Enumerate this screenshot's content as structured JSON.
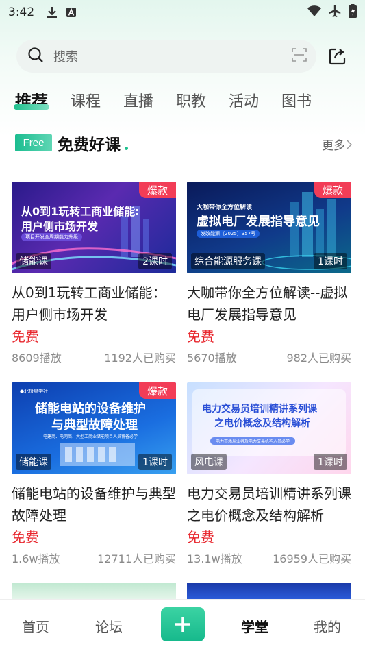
{
  "status_bar": {
    "time": "3:42"
  },
  "search": {
    "placeholder": "搜索"
  },
  "tabs": [
    "推荐",
    "课程",
    "直播",
    "职教",
    "活动",
    "图书"
  ],
  "section": {
    "tag": "Free",
    "title": "免费好课",
    "more": "更多"
  },
  "courses": [
    {
      "badge": "爆款",
      "thumb_title_1": "从0到1玩转工商业储能:",
      "thumb_title_2": "用户侧市场开发",
      "thumb_sub": "项目开发全周期能力升级",
      "category": "储能课",
      "duration": "2课时",
      "title": "从0到1玩转工商业储能：用户侧市场开发",
      "price": "免费",
      "plays": "8609播放",
      "buyers": "1192人已购买"
    },
    {
      "badge": "爆款",
      "thumb_title_1": "大咖带你全方位解读",
      "thumb_title_2": "虚拟电厂发展指导意见",
      "thumb_sub": "发改能源〔2025〕357号",
      "category": "综合能源服务课",
      "duration": "1课时",
      "title": "大咖带你全方位解读--虚拟电厂发展指导意见",
      "price": "免费",
      "plays": "5670播放",
      "buyers": "982人已购买"
    },
    {
      "badge": "爆款",
      "thumb_title_1": "储能电站的设备维护",
      "thumb_title_2": "与典型故障处理",
      "thumb_sub": "—电建商、电网商、大型工商业储能项目人员将备必学—",
      "category": "储能课",
      "duration": "1课时",
      "title": "储能电站的设备维护与典型故障处理",
      "price": "免费",
      "plays": "1.6w播放",
      "buyers": "12711人已购买"
    },
    {
      "badge": "",
      "thumb_title_1": "电力交易员培训精讲系列课",
      "thumb_title_2": "之电价概念及结构解析",
      "thumb_sub": "电力市场从业者及电力交易机构人员必学",
      "category": "风电课",
      "duration": "1课时",
      "title": "电力交易员培训精讲系列课之电价概念及结构解析",
      "price": "免费",
      "plays": "13.1w播放",
      "buyers": "16959人已购买"
    }
  ],
  "bottom_nav": [
    "首页",
    "论坛",
    "学堂",
    "我的"
  ],
  "colors": {
    "accent": "#1fc08e",
    "price": "#e8262d",
    "hot": "#f23d57"
  }
}
